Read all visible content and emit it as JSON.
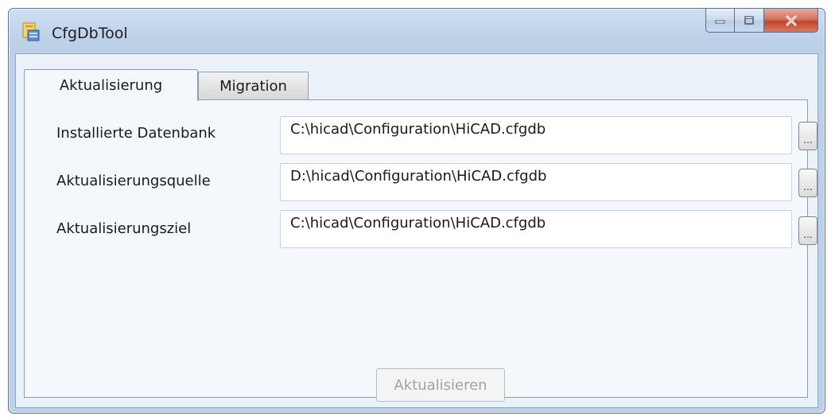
{
  "window": {
    "title": "CfgDbTool",
    "app_icon": "cfgdb-app-icon",
    "caption_icons": [
      "minimize-icon",
      "maximize-icon",
      "close-icon"
    ]
  },
  "tabs": [
    {
      "label": "Aktualisierung",
      "selected": true
    },
    {
      "label": "Migration",
      "selected": false
    }
  ],
  "rows": [
    {
      "label": "Installierte Datenbank",
      "value": "C:\\hicad\\Configuration\\HiCAD.cfgdb",
      "browse_label": "..."
    },
    {
      "label": "Aktualisierungsquelle",
      "value": "D:\\hicad\\Configuration\\HiCAD.cfgdb",
      "browse_label": "..."
    },
    {
      "label": "Aktualisierungsziel",
      "value": "C:\\hicad\\Configuration\\HiCAD.cfgdb",
      "browse_label": "..."
    }
  ],
  "actions": {
    "update_label": "Aktualisieren",
    "update_enabled": false
  },
  "colors": {
    "frame": "#bcd0e8",
    "client": "#eaf1f9",
    "close_button": "#c2462c"
  }
}
